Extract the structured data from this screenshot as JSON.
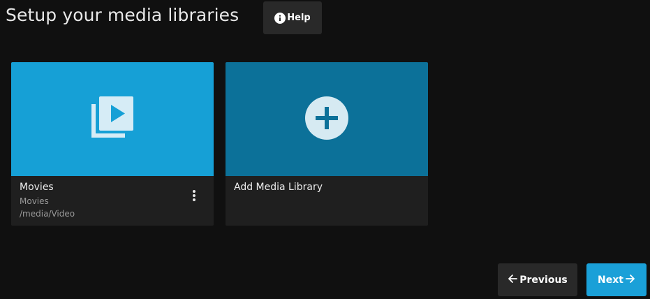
{
  "header": {
    "title": "Setup your media libraries",
    "help_label": "Help",
    "help_icon": "info-circle-icon"
  },
  "libraries": [
    {
      "title": "Movies",
      "type": "Movies",
      "path": "/media/Video",
      "icon": "video-library-icon",
      "color": "#16a0d6",
      "menu_icon": "more-vertical-icon"
    }
  ],
  "add_card": {
    "title": "Add Media Library",
    "icon": "add-circle-icon",
    "color": "#0c7199"
  },
  "footer": {
    "previous_label": "Previous",
    "previous_icon": "arrow-left-icon",
    "next_label": "Next",
    "next_icon": "arrow-right-icon",
    "next_color": "#1aa0d8"
  }
}
